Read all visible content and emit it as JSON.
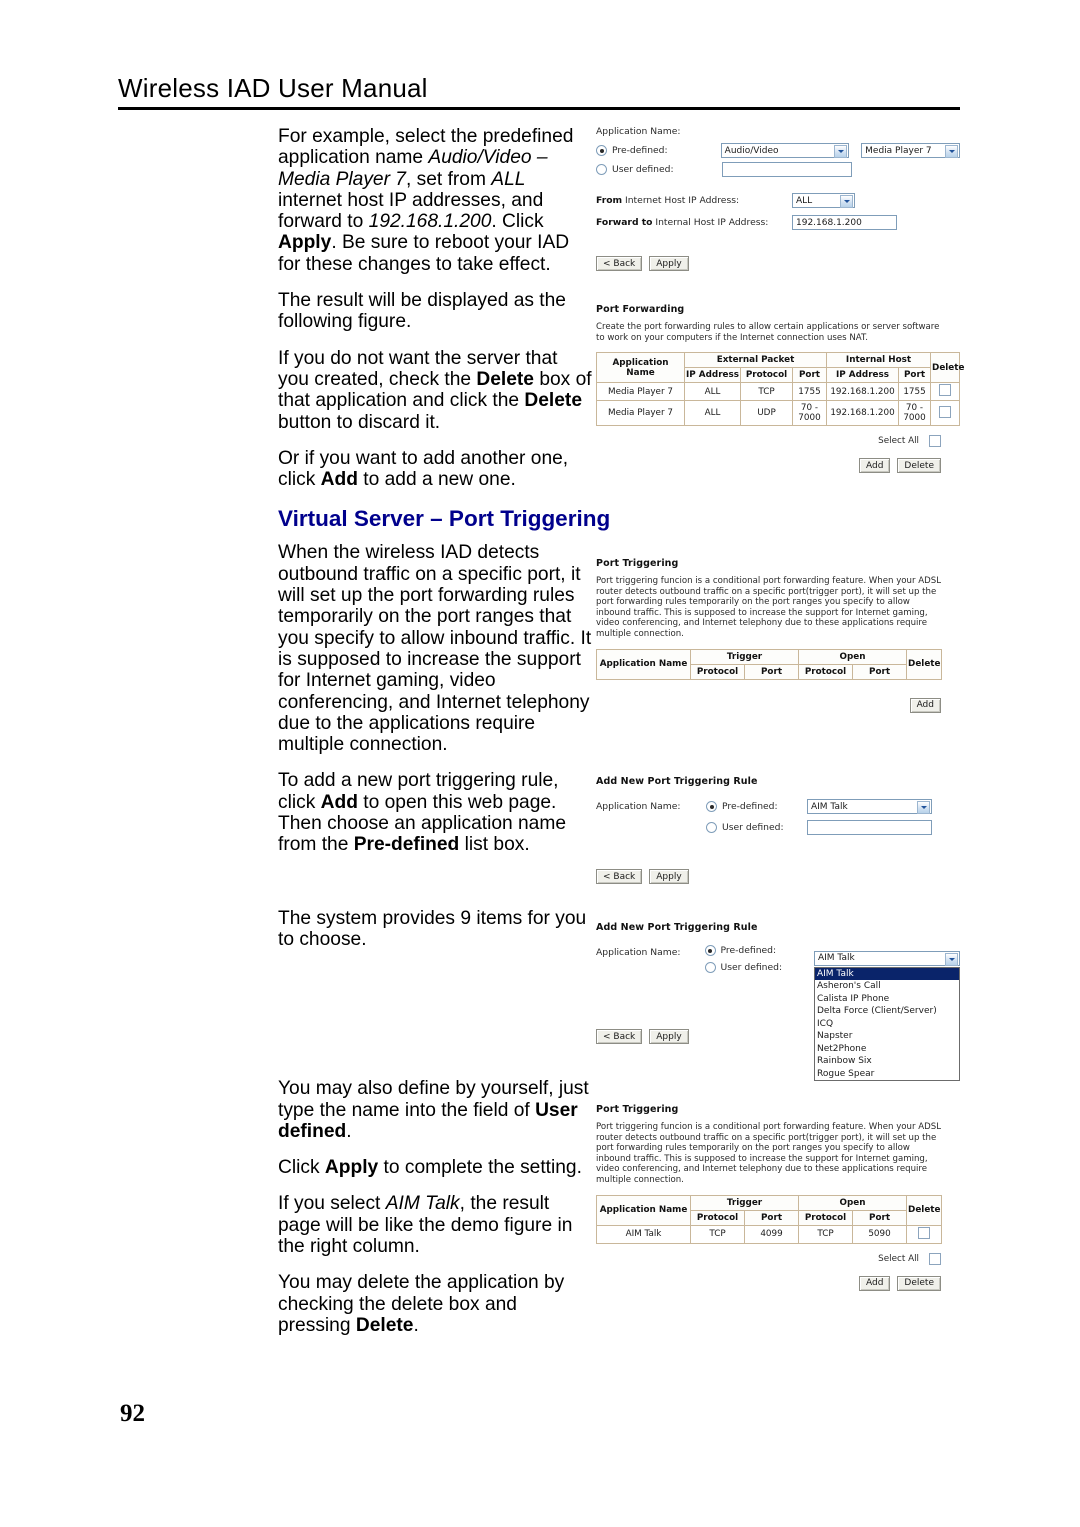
{
  "header": {
    "title": "Wireless IAD User Manual"
  },
  "page_number": "92",
  "body_text": {
    "p1_a": "For example, select the predefined application name ",
    "p1_i1": "Audio/Video – Media Player 7",
    "p1_b": ", set from ",
    "p1_i2": "ALL",
    "p1_c": " internet host IP addresses, and forward to ",
    "p1_i3": "192.168.1.200",
    "p1_d": ". Click ",
    "p1_bold": "Apply",
    "p1_e": ". Be sure to reboot your IAD for these changes to take effect.",
    "p2": "The result will be displayed as the following figure.",
    "p3_a": "If you do not want the server that you created, check the ",
    "p3_b1": "Delete",
    "p3_b": " box of that application and click the ",
    "p3_b2": "Delete",
    "p3_c": " button to discard it.",
    "p4_a": "Or if you want to add another one, click ",
    "p4_b": "Add",
    "p4_c": " to add a new one.",
    "section_heading": "Virtual Server – Port Triggering",
    "p5": "When the wireless IAD detects outbound traffic on a specific port, it will set up the port forwarding rules temporarily on the port ranges that you specify to allow inbound traffic. It is supposed to increase the support for Internet gaming, video conferencing, and Internet telephony due to the applications require multiple connection.",
    "p6_a": "To add a new port triggering rule, click ",
    "p6_b": "Add",
    "p6_c": " to open this web page. Then choose an application name from the ",
    "p6_b2": "Pre-defined",
    "p6_d": " list box.",
    "p7": "The system provides 9 items for you to choose.",
    "p8_a": "You may also define by yourself, just type the name into the field of ",
    "p8_b": "User defined",
    "p8_c": ".",
    "p9_a": "Click ",
    "p9_b": "Apply",
    "p9_c": " to complete the setting.",
    "p10_a": "If you select ",
    "p10_i": "AIM Talk",
    "p10_b": ", the result page will be like the demo figure in the right column.",
    "p11_a": "You may delete the application by checking the delete box and pressing ",
    "p11_b": "Delete",
    "p11_c": "."
  },
  "fig_virtual_server_form": {
    "app_name_label": "Application Name:",
    "predefined_label": "Pre-defined:",
    "userdefined_label": "User defined:",
    "category_value": "Audio/Video",
    "application_value": "Media Player 7",
    "userdefined_value": "",
    "from_label_bold": "From",
    "from_label_rest": " Internet Host IP Address:",
    "from_value": "ALL",
    "forward_label_bold": "Forward to",
    "forward_label_rest": " Internal Host IP Address:",
    "forward_value": "192.168.1.200",
    "back_button": "< Back",
    "apply_button": "Apply"
  },
  "fig_port_forwarding": {
    "title": "Port Forwarding",
    "description": "Create the port forwarding rules to allow certain applications or server software to work on your computers if the Internet connection uses NAT.",
    "headers": {
      "app_name": "Application Name",
      "external_packet": "External Packet",
      "internal_host": "Internal Host",
      "delete": "Delete",
      "ip_address": "IP Address",
      "protocol": "Protocol",
      "port": "Port"
    },
    "rows": [
      {
        "app": "Media Player 7",
        "ext_ip": "ALL",
        "ext_proto": "TCP",
        "ext_port": "1755",
        "int_ip": "192.168.1.200",
        "int_port": "1755"
      },
      {
        "app": "Media Player 7",
        "ext_ip": "ALL",
        "ext_proto": "UDP",
        "ext_port": "70 - 7000",
        "int_ip": "192.168.1.200",
        "int_port": "70 - 7000"
      }
    ],
    "select_all": "Select All",
    "add_button": "Add",
    "delete_button": "Delete"
  },
  "fig_port_triggering_empty": {
    "title": "Port Triggering",
    "description": "Port triggering funcion is a conditional port forwarding feature. When your ADSL router detects outbound traffic on a specific port(trigger port), it will set up the port forwarding rules temporarily on the port ranges you specify to allow inbound traffic. This is supposed to increase the support for Internet gaming, video conferencing, and Internet telephony due to these applications require multiple connection.",
    "headers": {
      "app_name": "Application Name",
      "trigger": "Trigger",
      "open": "Open",
      "delete": "Delete",
      "protocol": "Protocol",
      "port": "Port"
    },
    "add_button": "Add"
  },
  "fig_add_rule": {
    "title": "Add New Port Triggering Rule",
    "app_name_label": "Application Name:",
    "predefined_label": "Pre-defined:",
    "userdefined_label": "User defined:",
    "predefined_value": "AIM Talk",
    "userdefined_value": "",
    "back_button": "< Back",
    "apply_button": "Apply"
  },
  "fig_add_rule_open": {
    "title": "Add New Port Triggering Rule",
    "app_name_label": "Application Name:",
    "predefined_label": "Pre-defined:",
    "userdefined_label": "User defined:",
    "predefined_value": "AIM Talk",
    "back_button": "< Back",
    "apply_button": "Apply",
    "options": [
      "AIM Talk",
      "Asheron's Call",
      "Calista IP Phone",
      "Delta Force (Client/Server)",
      "ICQ",
      "Napster",
      "Net2Phone",
      "Rainbow Six",
      "Rogue Spear"
    ],
    "selected_index": 0
  },
  "fig_port_triggering_result": {
    "title": "Port Triggering",
    "description": "Port triggering funcion is a conditional port forwarding feature. When your ADSL router detects outbound traffic on a specific port(trigger port), it will set up the port forwarding rules temporarily on the port ranges you specify to allow inbound traffic. This is supposed to increase the support for Internet gaming, video conferencing, and Internet telephony due to these applications require multiple connection.",
    "headers": {
      "app_name": "Application Name",
      "trigger": "Trigger",
      "open": "Open",
      "delete": "Delete",
      "protocol": "Protocol",
      "port": "Port"
    },
    "rows": [
      {
        "app": "AIM Talk",
        "trig_proto": "TCP",
        "trig_port": "4099",
        "open_proto": "TCP",
        "open_port": "5090"
      }
    ],
    "select_all": "Select All",
    "add_button": "Add",
    "delete_button": "Delete"
  },
  "colors": {
    "heading": "#00008c",
    "table_border": "#c9b79a",
    "input_border": "#7f9db9",
    "select_highlight": "#0a246a"
  }
}
